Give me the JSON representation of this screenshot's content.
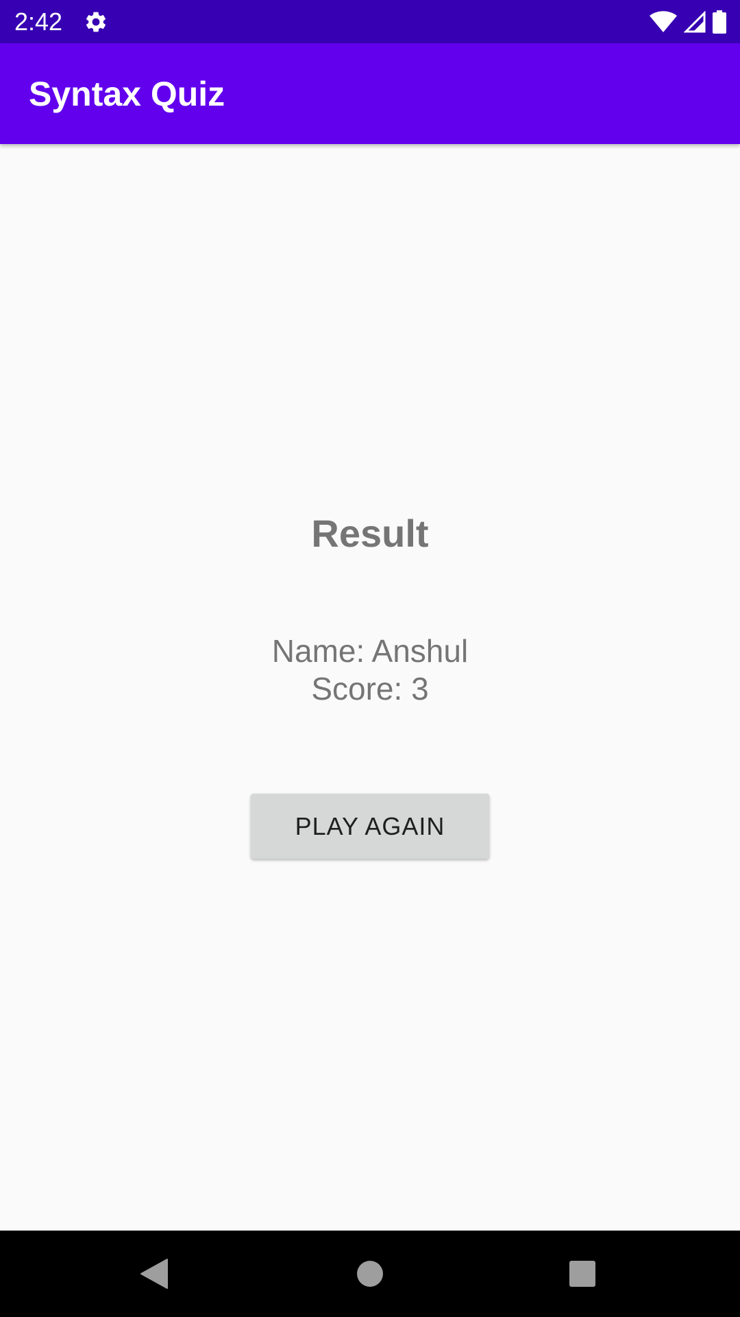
{
  "status_bar": {
    "time": "2:42",
    "icons": [
      "settings-gear-icon",
      "wifi-icon",
      "cell-signal-icon",
      "battery-icon"
    ],
    "background_color": "#3700b3"
  },
  "app_bar": {
    "title": "Syntax Quiz",
    "background_color": "#6200ee"
  },
  "result": {
    "title": "Result",
    "name_line": "Name: Anshul",
    "score_line": "Score: 3"
  },
  "actions": {
    "play_again_label": "PLAY AGAIN"
  },
  "nav_bar": {
    "buttons": [
      "back-icon",
      "home-icon",
      "recents-icon"
    ]
  }
}
